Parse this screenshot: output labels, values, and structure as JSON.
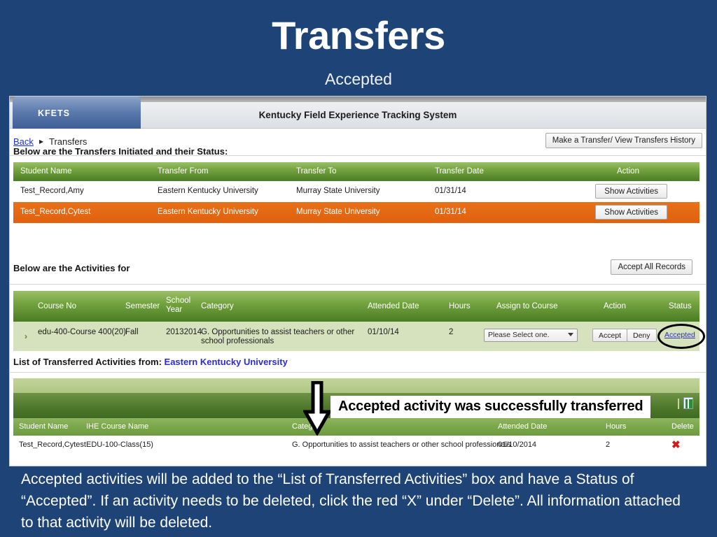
{
  "slide": {
    "title": "Transfers",
    "subtitle": "Accepted",
    "bg_color": "#1e4377",
    "caption": "Accepted activities will be added to the “List of Transferred Activities” box and have a Status of “Accepted”. If an activity needs to be deleted, click the red “X” under “Delete”. All information attached to that activity will be deleted."
  },
  "app": {
    "tab_label": "KFETS",
    "title": "Kentucky Field Experience Tracking System",
    "breadcrumb": {
      "back": "Back",
      "separator": "▸",
      "current": "Transfers"
    },
    "make_transfer_button": "Make a Transfer/ View Transfers History"
  },
  "transfers_section": {
    "label": "Below are the Transfers Initiated and their Status:",
    "headers": [
      "Student Name",
      "Transfer From",
      "Transfer To",
      "Transfer Date",
      "Action"
    ],
    "rows": [
      {
        "student_name": "Test_Record,Amy",
        "transfer_from": "Eastern Kentucky University",
        "transfer_to": "Murray State University",
        "transfer_date": "01/31/14",
        "action": "Show Activities",
        "selected": false
      },
      {
        "student_name": "Test_Record,Cytest",
        "transfer_from": "Eastern Kentucky University",
        "transfer_to": "Murray State University",
        "transfer_date": "01/31/14",
        "action": "Show Activities",
        "selected": true
      }
    ],
    "selected_row_color": "#e6690f"
  },
  "activities_section": {
    "label": "Below are the Activities for",
    "accept_all_button": "Accept All Records",
    "headers": [
      "Course No",
      "Semester",
      "School Year",
      "Category",
      "Attended Date",
      "Hours",
      "Assign to Course",
      "Action",
      "Status"
    ],
    "header_school_year_line1": "School",
    "header_school_year_line2": "Year",
    "row": {
      "expander": "›",
      "course_no": "edu-400-Course 400(20)",
      "semester": "Fall",
      "school_year": "20132014",
      "category": "G. Opportunities to assist teachers or other school professionals",
      "attended_date": "01/10/14",
      "hours": "2",
      "assign_to_course_value": "Please Select one.",
      "accept_button": "Accept",
      "deny_button": "Deny",
      "status": "Accepted",
      "status_color": "#2b2bcf"
    }
  },
  "transferred_section": {
    "label_prefix": "List of Transferred Activities from:",
    "label_university": "Eastern Kentucky University",
    "export_icon": "excel-export-icon",
    "headers": [
      "Student Name",
      "IHE Course Name",
      "Category",
      "Attended Date",
      "Hours",
      "Delete"
    ],
    "rows": [
      {
        "student_name": "Test_Record,Cytest",
        "ihe_course_name": "EDU-100-Class(15)",
        "category": "G. Opportunities to assist teachers or other school professionals",
        "attended_date": "01/10/2014",
        "hours": "2",
        "delete": "✖"
      }
    ],
    "delete_color": "#cc1f1f"
  },
  "annotation": {
    "arrow": "down-arrow-annotation",
    "callout_text": "Accepted activity was successfully transferred"
  }
}
